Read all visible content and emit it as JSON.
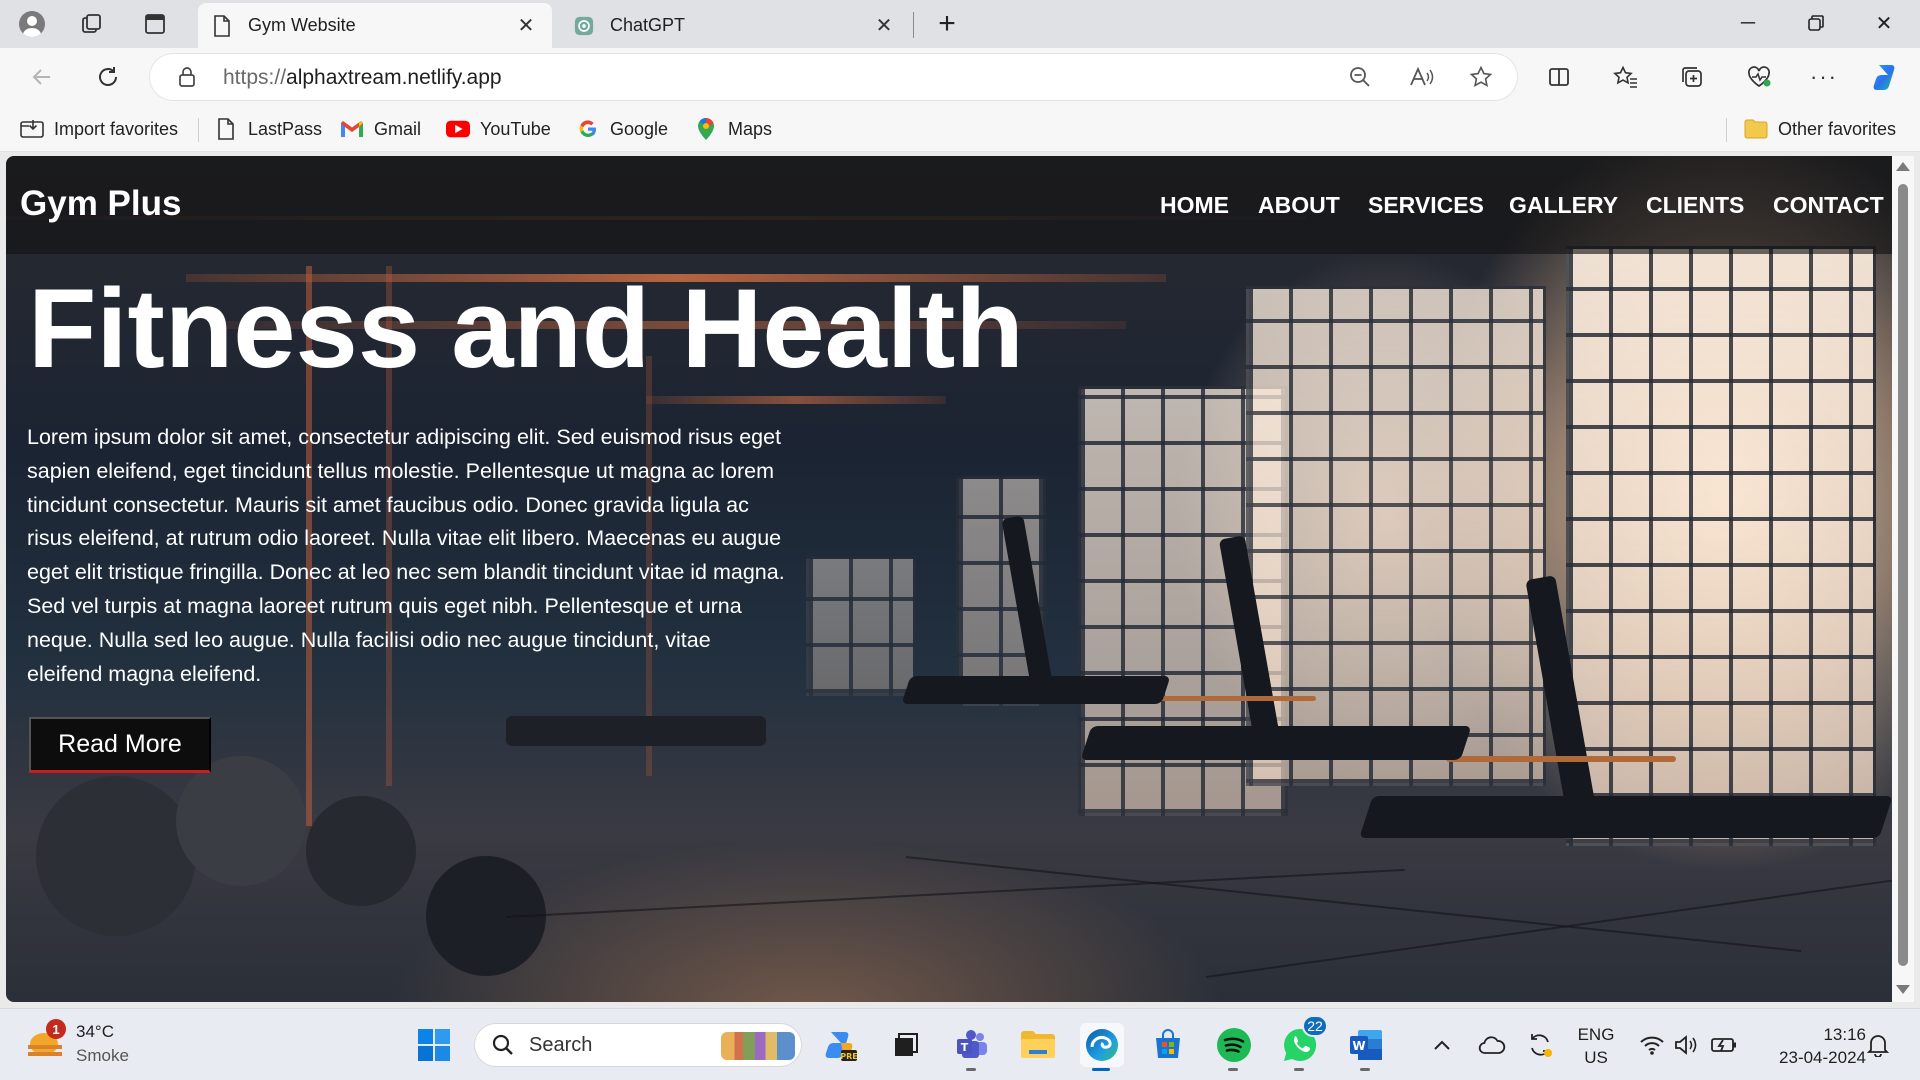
{
  "browser": {
    "tabs": [
      {
        "title": "Gym Website",
        "active": true,
        "favicon": "page-icon"
      },
      {
        "title": "ChatGPT",
        "active": false,
        "favicon": "chatgpt-icon"
      }
    ],
    "new_tab_symbol": "+",
    "url_scheme": "https://",
    "url_host": "alphaxtream.netlify.app",
    "favorites": [
      {
        "label": "Import favorites",
        "icon": "import-icon"
      },
      {
        "label": "LastPass",
        "icon": "page-icon"
      },
      {
        "label": "Gmail",
        "icon": "gmail-icon"
      },
      {
        "label": "YouTube",
        "icon": "youtube-icon"
      },
      {
        "label": "Google",
        "icon": "google-icon"
      },
      {
        "label": "Maps",
        "icon": "maps-icon"
      }
    ],
    "other_favorites": "Other favorites"
  },
  "site": {
    "logo": "Gym Plus",
    "nav": [
      "HOME",
      "ABOUT",
      "SERVICES",
      "GALLERY",
      "CLIENTS",
      "CONTACT"
    ],
    "hero_title": "Fitness and Health",
    "hero_text": "Lorem ipsum dolor sit amet, consectetur adipiscing elit. Sed euismod risus eget sapien eleifend, eget tincidunt tellus molestie. Pellentesque ut magna ac lorem tincidunt consectetur. Mauris sit amet faucibus odio. Donec gravida ligula ac risus eleifend, at rutrum odio laoreet. Nulla vitae elit libero. Maecenas eu augue eget elit tristique fringilla. Donec at leo nec sem blandit tincidunt vitae id magna. Sed vel turpis at magna laoreet rutrum quis eget nibh. Pellentesque et urna neque. Nulla sed leo augue. Nulla facilisi odio nec augue tincidunt, vitae eleifend magna eleifend.",
    "cta_label": "Read More"
  },
  "taskbar": {
    "weather_temp": "34°C",
    "weather_desc": "Smoke",
    "weather_badge": "1",
    "search_label": "Search",
    "whatsapp_badge": "22",
    "lang_line1": "ENG",
    "lang_line2": "US",
    "time": "13:16",
    "date": "23-04-2024"
  },
  "colors": {
    "accent": "#0067c0",
    "cta_border": "#c81e1e",
    "nav_overlay": "#121212"
  }
}
